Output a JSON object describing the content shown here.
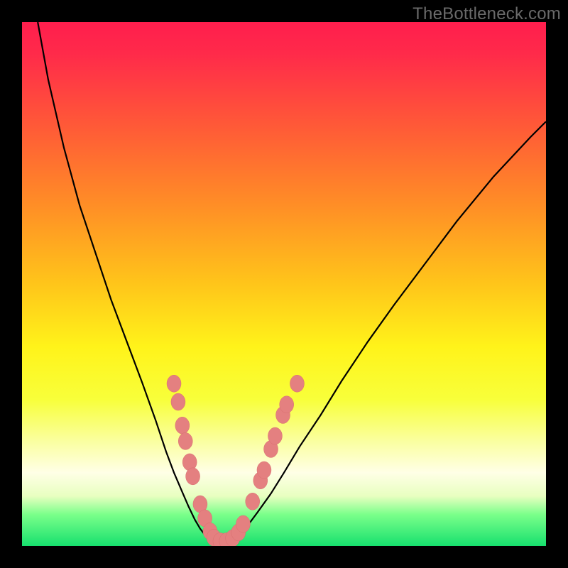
{
  "watermark": "TheBottleneck.com",
  "colors": {
    "frame": "#000000",
    "gradient_stops": [
      {
        "offset": 0.0,
        "color": "#ff1e4d"
      },
      {
        "offset": 0.06,
        "color": "#ff2a4a"
      },
      {
        "offset": 0.2,
        "color": "#ff5a37"
      },
      {
        "offset": 0.35,
        "color": "#ff8e26"
      },
      {
        "offset": 0.5,
        "color": "#ffc51a"
      },
      {
        "offset": 0.62,
        "color": "#fff31a"
      },
      {
        "offset": 0.72,
        "color": "#f8ff3a"
      },
      {
        "offset": 0.8,
        "color": "#faffa0"
      },
      {
        "offset": 0.86,
        "color": "#ffffe6"
      },
      {
        "offset": 0.905,
        "color": "#e8ffc0"
      },
      {
        "offset": 0.94,
        "color": "#7aff8a"
      },
      {
        "offset": 1.0,
        "color": "#17e06e"
      }
    ],
    "line": "#000000",
    "marker_fill": "#e48080",
    "marker_stroke": "#d86f6f"
  },
  "chart_data": {
    "type": "line",
    "title": "",
    "xlabel": "",
    "ylabel": "",
    "xlim": [
      0,
      100
    ],
    "ylim": [
      0,
      100
    ],
    "series": [
      {
        "name": "left-branch",
        "x": [
          3,
          5,
          8,
          11,
          14,
          17,
          20,
          23,
          25.5,
          27.5,
          29,
          30.5,
          31.8,
          33,
          34,
          35,
          36
        ],
        "y": [
          100,
          89,
          76,
          65,
          56,
          47,
          39,
          31,
          24,
          18,
          14,
          10.5,
          7.5,
          5,
          3.3,
          2,
          1.2
        ]
      },
      {
        "name": "valley-floor",
        "x": [
          36,
          37,
          38,
          39,
          40
        ],
        "y": [
          1.2,
          0.7,
          0.6,
          0.7,
          1.2
        ]
      },
      {
        "name": "right-branch",
        "x": [
          40,
          41.5,
          43,
          45,
          47.5,
          50,
          53,
          57,
          61,
          66,
          71,
          77,
          83,
          90,
          97,
          100
        ],
        "y": [
          1.2,
          2.2,
          3.8,
          6.5,
          10,
          14,
          19,
          25,
          31.5,
          39,
          46,
          54,
          62,
          70.5,
          78,
          81
        ]
      }
    ],
    "markers": {
      "name": "highlighted-points",
      "points": [
        {
          "x": 29.0,
          "y": 31.0
        },
        {
          "x": 29.8,
          "y": 27.5
        },
        {
          "x": 30.6,
          "y": 23.0
        },
        {
          "x": 31.2,
          "y": 20.0
        },
        {
          "x": 32.0,
          "y": 16.0
        },
        {
          "x": 32.6,
          "y": 13.3
        },
        {
          "x": 34.0,
          "y": 8.0
        },
        {
          "x": 34.9,
          "y": 5.3
        },
        {
          "x": 35.9,
          "y": 2.8
        },
        {
          "x": 36.6,
          "y": 1.6
        },
        {
          "x": 37.8,
          "y": 0.9
        },
        {
          "x": 39.0,
          "y": 0.9
        },
        {
          "x": 40.2,
          "y": 1.5
        },
        {
          "x": 41.3,
          "y": 2.6
        },
        {
          "x": 42.2,
          "y": 4.2
        },
        {
          "x": 44.0,
          "y": 8.5
        },
        {
          "x": 45.5,
          "y": 12.5
        },
        {
          "x": 46.2,
          "y": 14.5
        },
        {
          "x": 47.5,
          "y": 18.5
        },
        {
          "x": 48.3,
          "y": 21.0
        },
        {
          "x": 49.8,
          "y": 25.0
        },
        {
          "x": 50.5,
          "y": 27.0
        },
        {
          "x": 52.5,
          "y": 31.0
        }
      ]
    }
  }
}
